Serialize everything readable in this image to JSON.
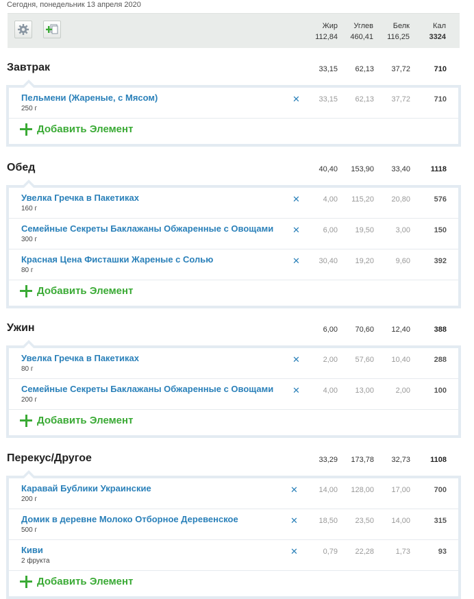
{
  "date_line": "Сегодня, понедельник 13 апреля 2020",
  "colors": {
    "link": "#2a80b9",
    "add": "#3aaa35",
    "box_border": "#e3ebf2",
    "header_bg": "#e9ecea"
  },
  "icons": {
    "settings": "gear-icon",
    "copy": "copy-add-icon",
    "remove": "close-icon",
    "add": "plus-icon"
  },
  "totals": {
    "labels": {
      "fat": "Жир",
      "carb": "Углев",
      "prot": "Белк",
      "cal": "Кал"
    },
    "values": {
      "fat": "112,84",
      "carb": "460,41",
      "prot": "116,25",
      "cal": "3324"
    }
  },
  "add_label": "Добавить Элемент",
  "meals": [
    {
      "title": "Завтрак",
      "sum": {
        "fat": "33,15",
        "carb": "62,13",
        "prot": "37,72",
        "cal": "710"
      },
      "items": [
        {
          "name": "Пельмени (Жареные, с Мясом)",
          "amount": "250 г",
          "fat": "33,15",
          "carb": "62,13",
          "prot": "37,72",
          "cal": "710"
        }
      ]
    },
    {
      "title": "Обед",
      "sum": {
        "fat": "40,40",
        "carb": "153,90",
        "prot": "33,40",
        "cal": "1118"
      },
      "items": [
        {
          "name": "Увелка Гречка в Пакетиках",
          "amount": "160 г",
          "fat": "4,00",
          "carb": "115,20",
          "prot": "20,80",
          "cal": "576"
        },
        {
          "name": "Семейные Секреты Баклажаны Обжаренные с Овощами",
          "amount": "300 г",
          "fat": "6,00",
          "carb": "19,50",
          "prot": "3,00",
          "cal": "150"
        },
        {
          "name": "Красная Цена Фисташки Жареные с Солью",
          "amount": "80 г",
          "fat": "30,40",
          "carb": "19,20",
          "prot": "9,60",
          "cal": "392"
        }
      ]
    },
    {
      "title": "Ужин",
      "sum": {
        "fat": "6,00",
        "carb": "70,60",
        "prot": "12,40",
        "cal": "388"
      },
      "items": [
        {
          "name": "Увелка Гречка в Пакетиках",
          "amount": "80 г",
          "fat": "2,00",
          "carb": "57,60",
          "prot": "10,40",
          "cal": "288"
        },
        {
          "name": "Семейные Секреты Баклажаны Обжаренные с Овощами",
          "amount": "200 г",
          "fat": "4,00",
          "carb": "13,00",
          "prot": "2,00",
          "cal": "100"
        }
      ]
    },
    {
      "title": "Перекус/Другое",
      "sum": {
        "fat": "33,29",
        "carb": "173,78",
        "prot": "32,73",
        "cal": "1108"
      },
      "items": [
        {
          "name": "Каравай Бублики Украинские",
          "amount": "200 г",
          "fat": "14,00",
          "carb": "128,00",
          "prot": "17,00",
          "cal": "700"
        },
        {
          "name": "Домик в деревне Молоко Отборное Деревенское",
          "amount": "500 г",
          "fat": "18,50",
          "carb": "23,50",
          "prot": "14,00",
          "cal": "315"
        },
        {
          "name": "Киви",
          "amount": "2 фрукта",
          "fat": "0,79",
          "carb": "22,28",
          "prot": "1,73",
          "cal": "93"
        }
      ]
    }
  ]
}
